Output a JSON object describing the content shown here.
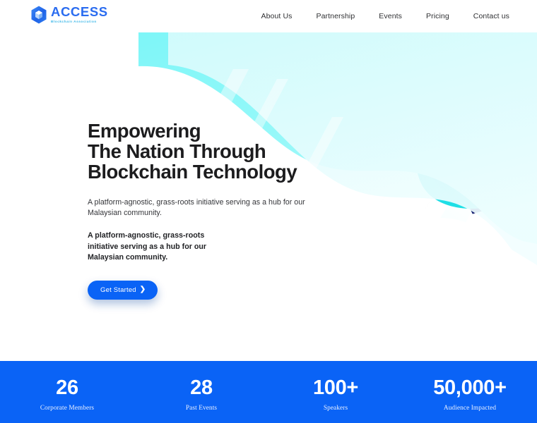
{
  "brand": {
    "name": "ACCESS",
    "tagline": "Blockchain Association",
    "logo_icon": "hexagon-cube-icon",
    "logo_color": "#2a6cf0",
    "tagline_color": "#38b6e8"
  },
  "nav": {
    "items": [
      {
        "label": "About Us"
      },
      {
        "label": "Partnership"
      },
      {
        "label": "Events"
      },
      {
        "label": "Pricing"
      },
      {
        "label": "Contact us"
      }
    ]
  },
  "hero": {
    "headline": "Empowering\nThe Nation Through\nBlockchain Technology",
    "paragraph": "A platform-agnostic, grass-roots initiative serving as a hub for our Malaysian community.",
    "paragraph_bold": "A platform-agnostic, grass-roots\ninitiative serving as a hub for our\nMalaysian community.",
    "cta_label": "Get Started",
    "cta_chevron": "❯",
    "cta_color": "#0a63f6",
    "illustration": "rocket-launch-illustration",
    "background_colors": {
      "space_deep": "#1a4ff0",
      "space_mid": "#1e7ef0",
      "wave_turquoise": "#12d7e8",
      "wave_cyan": "#8ff6f6",
      "wave_pale": "#d9fbfb",
      "white": "#ffffff"
    }
  },
  "stats": {
    "background_color": "#0a63f6",
    "items": [
      {
        "value": "26",
        "label": "Corporate Members"
      },
      {
        "value": "28",
        "label": "Past Events"
      },
      {
        "value": "100+",
        "label": "Speakers"
      },
      {
        "value": "50,000+",
        "label": "Audience Impacted"
      }
    ]
  }
}
